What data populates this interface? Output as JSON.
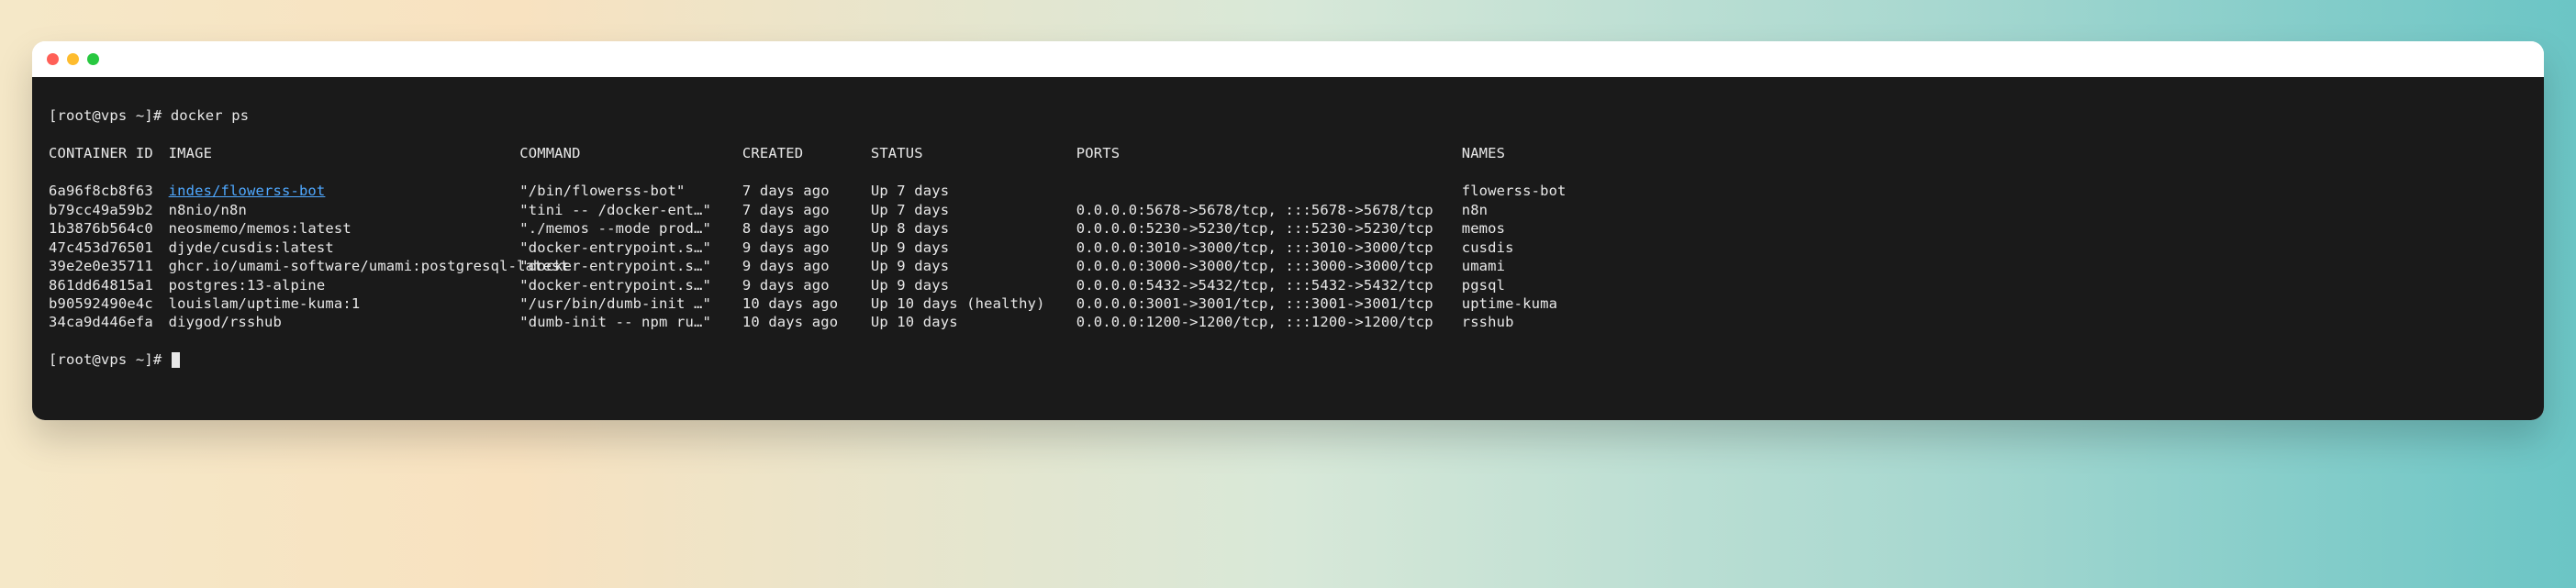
{
  "prompt_line": "[root@vps ~]# docker ps",
  "prompt_end": "[root@vps ~]# ",
  "headers": {
    "id": "CONTAINER ID",
    "image": "IMAGE",
    "command": "COMMAND",
    "created": "CREATED",
    "status": "STATUS",
    "ports": "PORTS",
    "names": "NAMES"
  },
  "rows": [
    {
      "id": "6a96f8cb8f63",
      "image": "indes/flowerss-bot",
      "image_link": true,
      "command": "\"/bin/flowerss-bot\"",
      "created": "7 days ago",
      "status": "Up 7 days",
      "ports": "",
      "names": "flowerss-bot"
    },
    {
      "id": "b79cc49a59b2",
      "image": "n8nio/n8n",
      "command": "\"tini -- /docker-ent…\"",
      "created": "7 days ago",
      "status": "Up 7 days",
      "ports": "0.0.0.0:5678->5678/tcp, :::5678->5678/tcp",
      "names": "n8n"
    },
    {
      "id": "1b3876b564c0",
      "image": "neosmemo/memos:latest",
      "command": "\"./memos --mode prod…\"",
      "created": "8 days ago",
      "status": "Up 8 days",
      "ports": "0.0.0.0:5230->5230/tcp, :::5230->5230/tcp",
      "names": "memos"
    },
    {
      "id": "47c453d76501",
      "image": "djyde/cusdis:latest",
      "command": "\"docker-entrypoint.s…\"",
      "created": "9 days ago",
      "status": "Up 9 days",
      "ports": "0.0.0.0:3010->3000/tcp, :::3010->3000/tcp",
      "names": "cusdis"
    },
    {
      "id": "39e2e0e35711",
      "image": "ghcr.io/umami-software/umami:postgresql-latest",
      "command": "\"docker-entrypoint.s…\"",
      "created": "9 days ago",
      "status": "Up 9 days",
      "ports": "0.0.0.0:3000->3000/tcp, :::3000->3000/tcp",
      "names": "umami"
    },
    {
      "id": "861dd64815a1",
      "image": "postgres:13-alpine",
      "command": "\"docker-entrypoint.s…\"",
      "created": "9 days ago",
      "status": "Up 9 days",
      "ports": "0.0.0.0:5432->5432/tcp, :::5432->5432/tcp",
      "names": "pgsql"
    },
    {
      "id": "b90592490e4c",
      "image": "louislam/uptime-kuma:1",
      "command": "\"/usr/bin/dumb-init …\"",
      "created": "10 days ago",
      "status": "Up 10 days (healthy)",
      "ports": "0.0.0.0:3001->3001/tcp, :::3001->3001/tcp",
      "names": "uptime-kuma"
    },
    {
      "id": "34ca9d446efa",
      "image": "diygod/rsshub",
      "command": "\"dumb-init -- npm ru…\"",
      "created": "10 days ago",
      "status": "Up 10 days",
      "ports": "0.0.0.0:1200->1200/tcp, :::1200->1200/tcp",
      "names": "rsshub"
    }
  ]
}
